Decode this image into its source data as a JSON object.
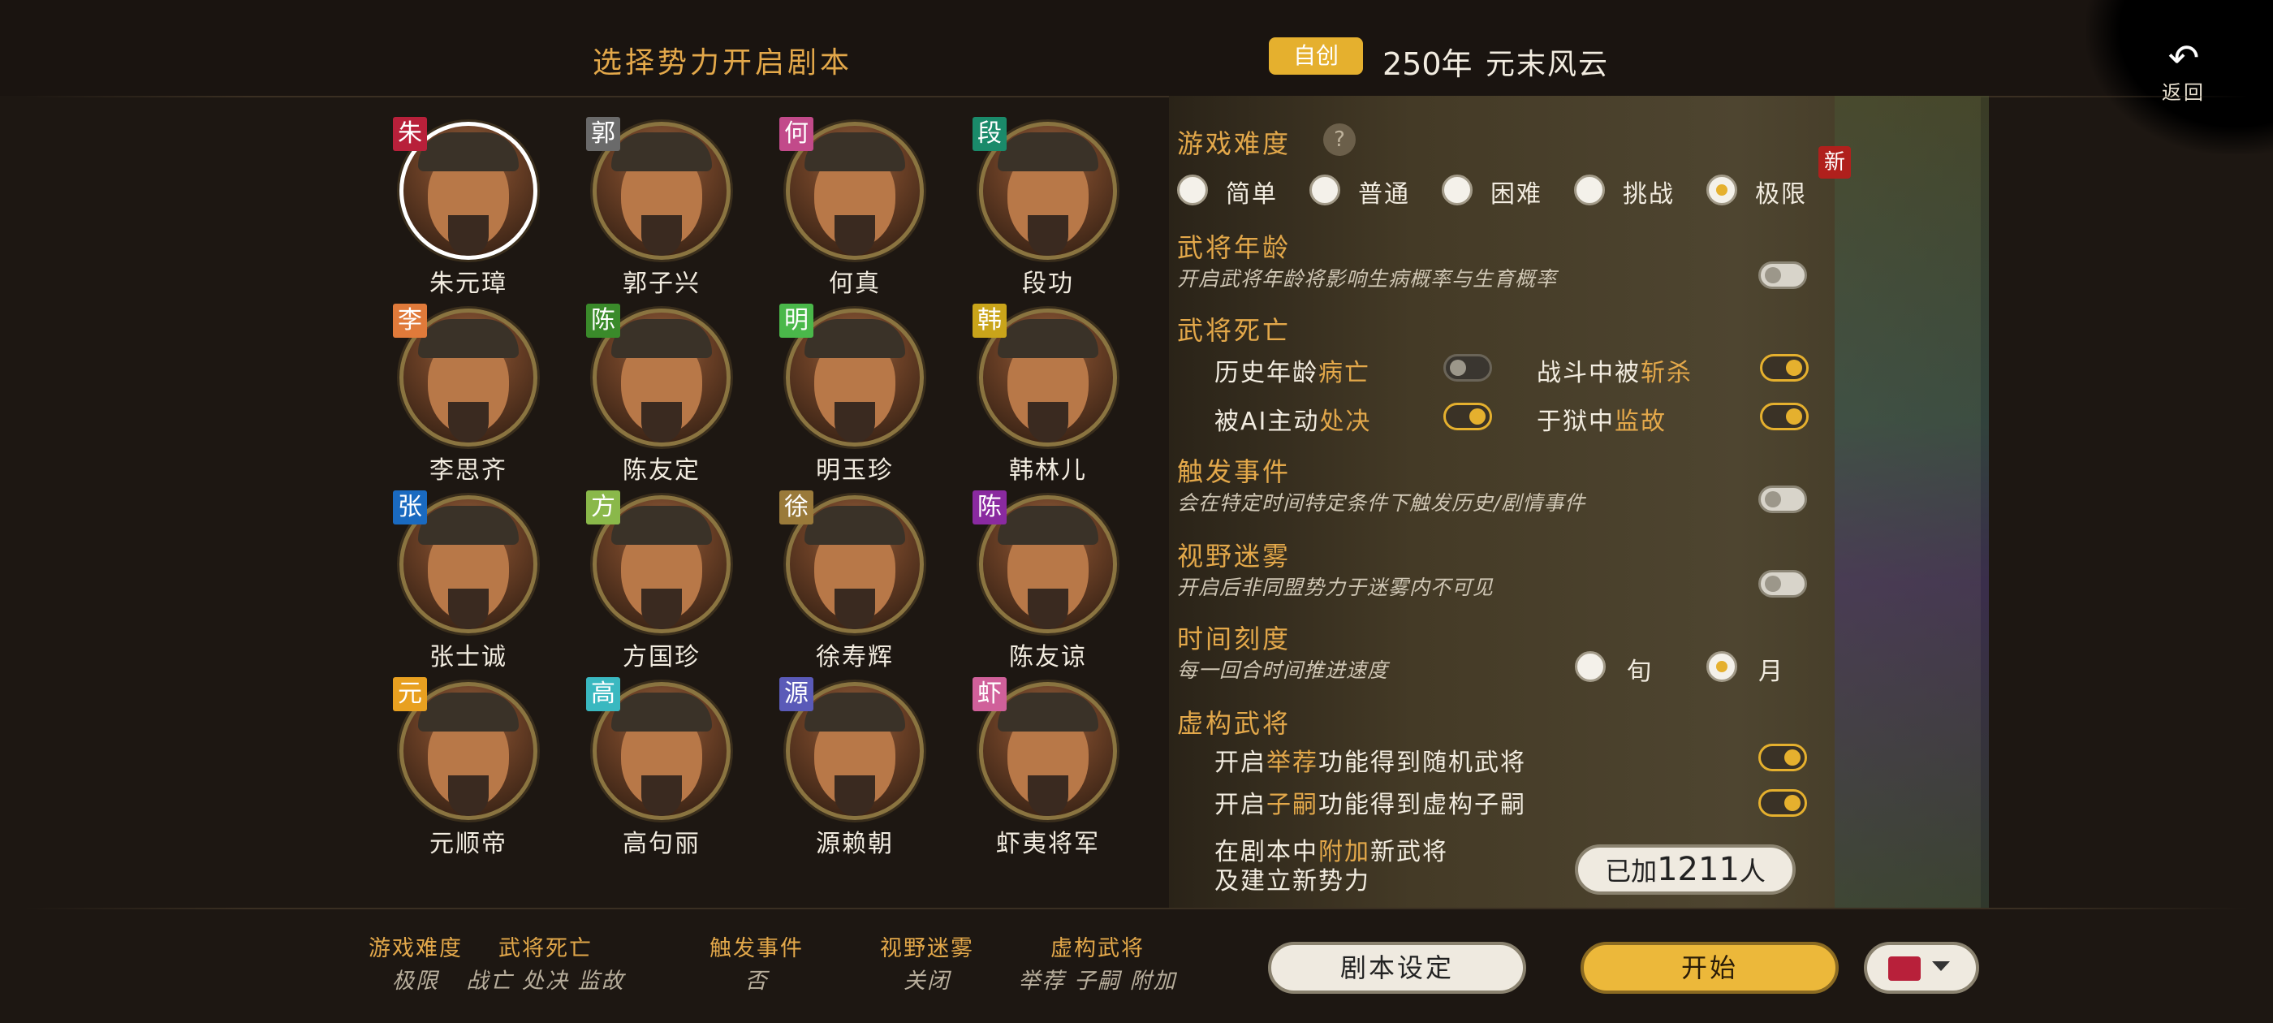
{
  "header": {
    "title": "选择势力开启剧本",
    "mode_badge": "自创",
    "scenario_year": "250年",
    "scenario_name": "元末风云",
    "back_label": "返回"
  },
  "lords": [
    {
      "name": "朱元璋",
      "badge": "朱",
      "badge_color": "#b8203a",
      "selected": true
    },
    {
      "name": "郭子兴",
      "badge": "郭",
      "badge_color": "#6a6a6a",
      "selected": false
    },
    {
      "name": "何真",
      "badge": "何",
      "badge_color": "#c24a8a",
      "selected": false
    },
    {
      "name": "段功",
      "badge": "段",
      "badge_color": "#1a8a6a",
      "selected": false
    },
    {
      "name": "李思齐",
      "badge": "李",
      "badge_color": "#e07a3a",
      "selected": false
    },
    {
      "name": "陈友定",
      "badge": "陈",
      "badge_color": "#3a8a2a",
      "selected": false
    },
    {
      "name": "明玉珍",
      "badge": "明",
      "badge_color": "#4ab84a",
      "selected": false
    },
    {
      "name": "韩林儿",
      "badge": "韩",
      "badge_color": "#c9a41a",
      "selected": false
    },
    {
      "name": "张士诚",
      "badge": "张",
      "badge_color": "#1a6ac0",
      "selected": false
    },
    {
      "name": "方国珍",
      "badge": "方",
      "badge_color": "#8ab84a",
      "selected": false
    },
    {
      "name": "徐寿辉",
      "badge": "徐",
      "badge_color": "#9a7a3a",
      "selected": false
    },
    {
      "name": "陈友谅",
      "badge": "陈",
      "badge_color": "#8a2aa0",
      "selected": false
    },
    {
      "name": "元顺帝",
      "badge": "元",
      "badge_color": "#e8a020",
      "selected": false
    },
    {
      "name": "高句丽",
      "badge": "高",
      "badge_color": "#3ab8c0",
      "selected": false
    },
    {
      "name": "源赖朝",
      "badge": "源",
      "badge_color": "#5a5ab8",
      "selected": false
    },
    {
      "name": "虾夷将军",
      "badge": "虾",
      "badge_color": "#d0609a",
      "selected": false
    }
  ],
  "settings": {
    "difficulty": {
      "title": "游戏难度",
      "help": "?",
      "new_badge": "新",
      "options": [
        "简单",
        "普通",
        "困难",
        "挑战",
        "极限"
      ],
      "selected": 4
    },
    "general_age": {
      "title": "武将年龄",
      "desc": "开启武将年龄将影响生病概率与生育概率",
      "enabled": false
    },
    "general_death": {
      "title": "武将死亡",
      "historical_age": {
        "pre": "历史年龄",
        "hl": "病亡",
        "enabled": false
      },
      "killed_in_battle": {
        "pre": "战斗中被",
        "hl": "斩杀",
        "enabled": true
      },
      "ai_execute": {
        "pre": "被AI主动",
        "hl": "处决",
        "enabled": true
      },
      "jailed": {
        "pre": "于狱中",
        "hl": "监故",
        "enabled": true
      }
    },
    "events": {
      "title": "触发事件",
      "desc": "会在特定时间特定条件下触发历史/剧情事件",
      "enabled": false
    },
    "fog": {
      "title": "视野迷雾",
      "desc": "开启后非同盟势力于迷雾内不可见",
      "enabled": false
    },
    "time_scale": {
      "title": "时间刻度",
      "desc": "每一回合时间推进速度",
      "options": [
        "旬",
        "月"
      ],
      "selected": 1
    },
    "fictional": {
      "title": "虚构武将",
      "recommend": {
        "pre": "开启",
        "hl": "举荐",
        "post": "功能得到随机武将",
        "enabled": true
      },
      "heir": {
        "pre": "开启",
        "hl": "子嗣",
        "post": "功能得到虚构子嗣",
        "enabled": true
      },
      "append_line1_pre": "在剧本中",
      "append_line1_hl": "附加",
      "append_line1_post": "新武将",
      "append_line2": "及建立新势力",
      "added_prefix": "已加",
      "added_count": "1211",
      "added_suffix": "人"
    }
  },
  "summary": [
    {
      "label": "游戏难度",
      "value": "极限"
    },
    {
      "label": "武将死亡",
      "value": "战亡 处决 监故"
    },
    {
      "label": "触发事件",
      "value": "否"
    },
    {
      "label": "视野迷雾",
      "value": "关闭"
    },
    {
      "label": "虚构武将",
      "value": "举荐 子嗣 附加"
    }
  ],
  "buttons": {
    "scenario_settings": "剧本设定",
    "start": "开始",
    "player_color": "#b8203a"
  }
}
